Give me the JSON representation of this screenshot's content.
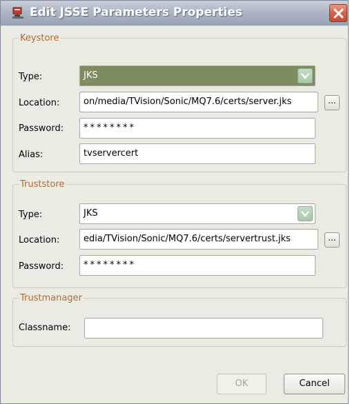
{
  "window": {
    "title": "Edit JSSE Parameters Properties",
    "title_icon": "properties-icon",
    "close_icon": "close-icon"
  },
  "keystore": {
    "legend": "Keystore",
    "type_label": "Type:",
    "type_value": "JKS",
    "location_label": "Location:",
    "location_value": "on/media/TVision/Sonic/MQ7.6/certs/server.jks",
    "password_label": "Password:",
    "password_value": "********",
    "alias_label": "Alias:",
    "alias_value": "tvservercert",
    "browse_label": "..."
  },
  "truststore": {
    "legend": "Truststore",
    "type_label": "Type:",
    "type_value": "JKS",
    "location_label": "Location:",
    "location_value": "edia/TVision/Sonic/MQ7.6/certs/servertrust.jks",
    "password_label": "Password:",
    "password_value": "********",
    "browse_label": "..."
  },
  "trustmanager": {
    "legend": "Trustmanager",
    "classname_label": "Classname:",
    "classname_value": ""
  },
  "buttons": {
    "ok_label": "OK",
    "cancel_label": "Cancel"
  },
  "colors": {
    "legend": "#b06a35",
    "selected_combo": "#7d8c61",
    "combo_arrow": "#a9c6ab",
    "close_button": "#d4634a"
  }
}
